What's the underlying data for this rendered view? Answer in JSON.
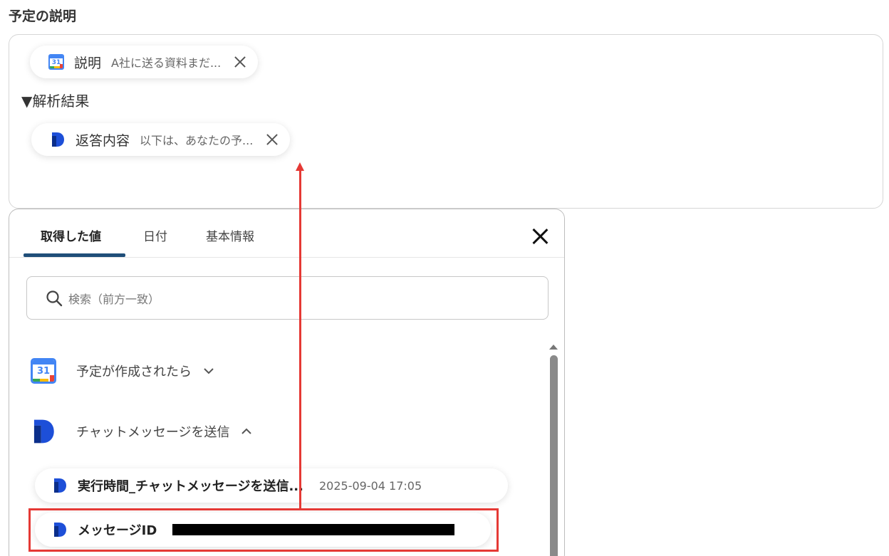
{
  "section": {
    "title": "予定の説明"
  },
  "editor": {
    "chip1": {
      "icon": "google-calendar-icon",
      "icon_text": "31",
      "name": "説明",
      "value": "A社に送る資料まだ..."
    },
    "plain_text": "▼解析結果",
    "chip2": {
      "icon": "dify-icon",
      "name": "返答内容",
      "value": "以下は、あなたの予..."
    }
  },
  "popup": {
    "tabs": [
      {
        "label": "取得した値",
        "active": true
      },
      {
        "label": "日付",
        "active": false
      },
      {
        "label": "基本情報",
        "active": false
      }
    ],
    "search": {
      "placeholder": "検索（前方一致）"
    },
    "groups": [
      {
        "icon": "google-calendar-icon",
        "icon_text": "31",
        "label": "予定が作成されたら",
        "expanded": false
      },
      {
        "icon": "dify-icon",
        "label": "チャットメッセージを送信",
        "expanded": true
      }
    ],
    "items": [
      {
        "name": "実行時間_チャットメッセージを送信...",
        "value": "2025-09-04 17:05"
      },
      {
        "name": "メッセージID",
        "value": ""
      }
    ]
  },
  "colors": {
    "accent": "#1f4e79",
    "annotation": "#e53935"
  }
}
